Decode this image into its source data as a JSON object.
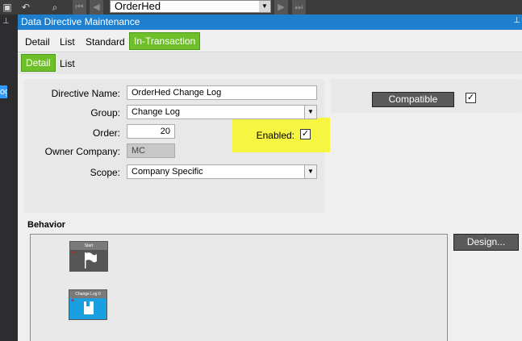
{
  "toolbar": {
    "record_value": "OrderHed"
  },
  "window": {
    "title": "Data Directive Maintenance"
  },
  "left_tab": {
    "label": "og"
  },
  "tabs": [
    {
      "label": "Detail"
    },
    {
      "label": "List"
    },
    {
      "label": "Standard"
    },
    {
      "label": "In-Transaction"
    }
  ],
  "subtabs": [
    {
      "label": "Detail"
    },
    {
      "label": "List"
    }
  ],
  "form": {
    "directive_name_label": "Directive Name:",
    "directive_name_value": "OrderHed Change Log",
    "group_label": "Group:",
    "group_value": "Change Log",
    "order_label": "Order:",
    "order_value": "20",
    "owner_company_label": "Owner Company:",
    "owner_company_value": "MC",
    "scope_label": "Scope:",
    "scope_value": "Company Specific",
    "enabled_label": "Enabled:",
    "enabled_checked": true
  },
  "compat": {
    "button_label": "Compatible",
    "checked": true
  },
  "behavior": {
    "section_label": "Behavior",
    "design_button": "Design...",
    "nodes": [
      {
        "label": "Start"
      },
      {
        "label": "Change Log 0"
      }
    ]
  },
  "colors": {
    "title_bar": "#1e7fce",
    "active_tab": "#6fbf2b",
    "highlight": "#f5f542",
    "action_node": "#1aa0e0"
  }
}
